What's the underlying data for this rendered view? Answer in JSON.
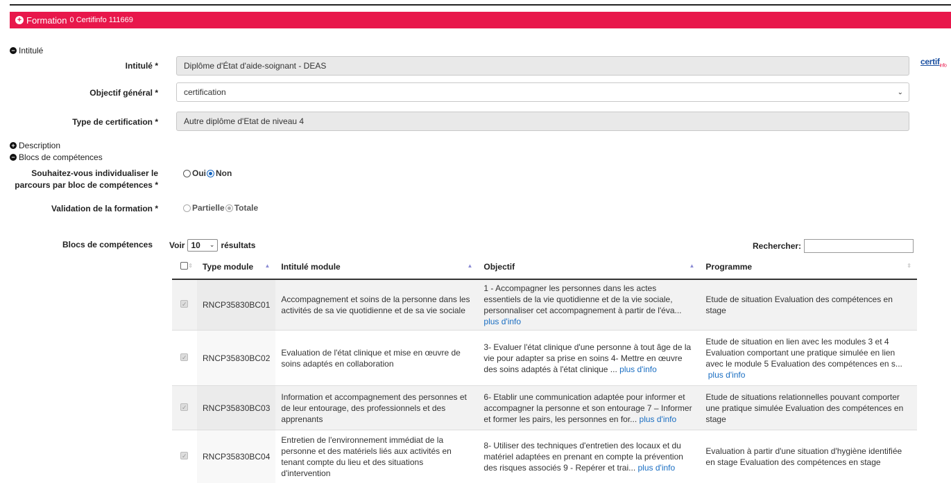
{
  "header": {
    "title": "Formation",
    "subtitle": "0 Certifinfo 111669"
  },
  "sections": {
    "intitule": "Intitulé",
    "description": "Description",
    "blocs": "Blocs de compétences"
  },
  "form": {
    "intitule_label": "Intitulé *",
    "intitule_value": "Diplôme d'État d'aide-soignant - DEAS",
    "objectif_label": "Objectif général *",
    "objectif_value": "certification",
    "type_label": "Type de certification *",
    "type_value": "Autre diplôme d'Etat de niveau 4",
    "individualiser_label_1": "Souhaitez-vous individualiser le",
    "individualiser_label_2": "parcours par bloc de compétences *",
    "individualiser_oui": "Oui",
    "individualiser_non": "Non",
    "validation_label": "Validation de la formation *",
    "validation_partielle": "Partielle",
    "validation_totale": "Totale",
    "blocs_label": "Blocs de compétences"
  },
  "certif_logo": {
    "text": "certif",
    "sub": "info"
  },
  "table": {
    "voir_label": "Voir",
    "page_size": "10",
    "resultats_label": "résultats",
    "search_label": "Rechercher:",
    "columns": [
      "Type module",
      "Intitulé module",
      "Objectif",
      "Programme"
    ],
    "more_label": "plus d'info",
    "rows": [
      {
        "code": "RNCP35830BC01",
        "intitule": "Accompagnement et soins de la personne dans les activités de sa vie quotidienne et de sa vie sociale",
        "objectif": "1 - Accompagner les personnes dans les actes essentiels de la vie quotidienne et de la vie sociale, personnaliser cet accompagnement à partir de l'éva...",
        "programme": "Etude de situation Evaluation des compétences en stage",
        "programme_more": false
      },
      {
        "code": "RNCP35830BC02",
        "intitule": "Evaluation de l'état clinique et mise en œuvre de soins adaptés en collaboration",
        "objectif": "3- Evaluer l'état clinique d'une personne à tout âge de la vie pour adapter sa prise en soins 4- Mettre en œuvre des soins adaptés à l'état clinique ...",
        "programme": "Etude de situation en lien avec les modules 3 et 4 Evaluation comportant une pratique simulée en lien avec le module 5 Evaluation des compétences en s...",
        "programme_more": true
      },
      {
        "code": "RNCP35830BC03",
        "intitule": "Information et accompagnement des personnes et de leur entourage, des professionnels et des apprenants",
        "objectif": "6- Etablir une communication adaptée pour informer et accompagner la personne et son entourage 7 – Informer et former les pairs, les personnes en for...",
        "programme": "Etude de situations relationnelles pouvant comporter une pratique simulée Evaluation des compétences en stage",
        "programme_more": false
      },
      {
        "code": "RNCP35830BC04",
        "intitule": "Entretien de l'environnement immédiat de la personne et des matériels liés aux activités en tenant compte du lieu et des situations d'intervention",
        "objectif": "8- Utiliser des techniques d'entretien des locaux et du matériel adaptées en prenant en compte la prévention des risques associés 9 - Repérer et trai...",
        "programme": "Evaluation à partir d'une situation d'hygiène identifiée en stage Evaluation des compétences en stage",
        "programme_more": false
      }
    ]
  },
  "colors": {
    "header_bg": "#e8174b",
    "link": "#1a6ec2",
    "radio_on": "#1565c0"
  }
}
